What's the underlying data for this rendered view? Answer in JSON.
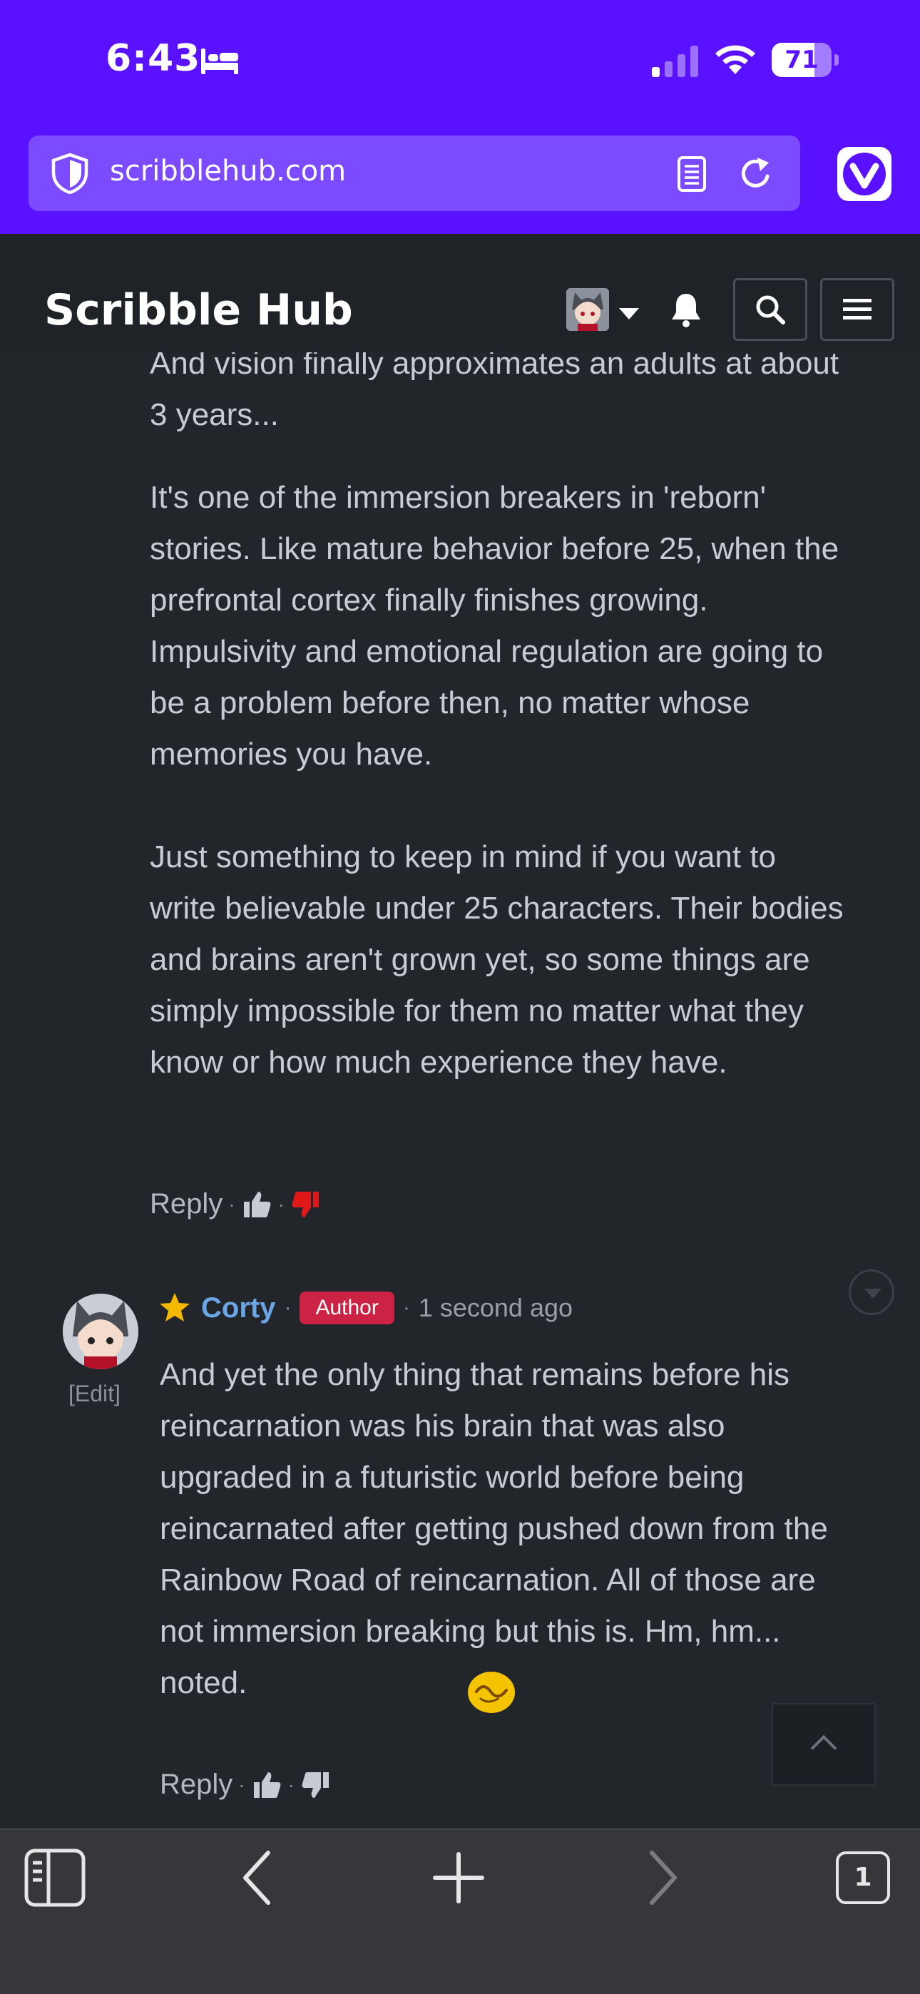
{
  "status_bar": {
    "time": "6:43",
    "battery": "71",
    "battery_level": 0.71
  },
  "browser": {
    "url": "scribblehub.com"
  },
  "site": {
    "title": "Scribble Hub"
  },
  "comments": {
    "previous": {
      "paragraphs": [
        "And vision finally approximates an adults at about 3 years...",
        "It's one of the immersion breakers in 'reborn' stories. Like mature behavior before 25, when the prefrontal cortex finally finishes growing. Impulsivity and emotional regulation are going to be a problem before then, no matter whose memories you have.",
        "Just something to keep in mind if you want to write believable under 25 characters. Their bodies and brains aren't grown yet, so some things are simply impossible for them no matter what they know or how much experience they have."
      ],
      "reply_label": "Reply"
    },
    "reply": {
      "author": "Corty",
      "badge": "Author",
      "time": "1 second ago",
      "edit_label": "Edit",
      "text": "And yet the only thing that remains before his reincarnation was his brain that was also upgraded in a futuristic world before being reincarnated after getting pushed down from the Rainbow Road of reincarnation. All of those are not immersion breaking but this is. Hm, hm... noted.",
      "reply_label": "Reply"
    }
  },
  "toolbar": {
    "tab_count": "1"
  },
  "colors": {
    "accent": "#5a11ff",
    "background": "#22262b",
    "author_badge": "#cc2244",
    "name": "#6aa6e6"
  }
}
